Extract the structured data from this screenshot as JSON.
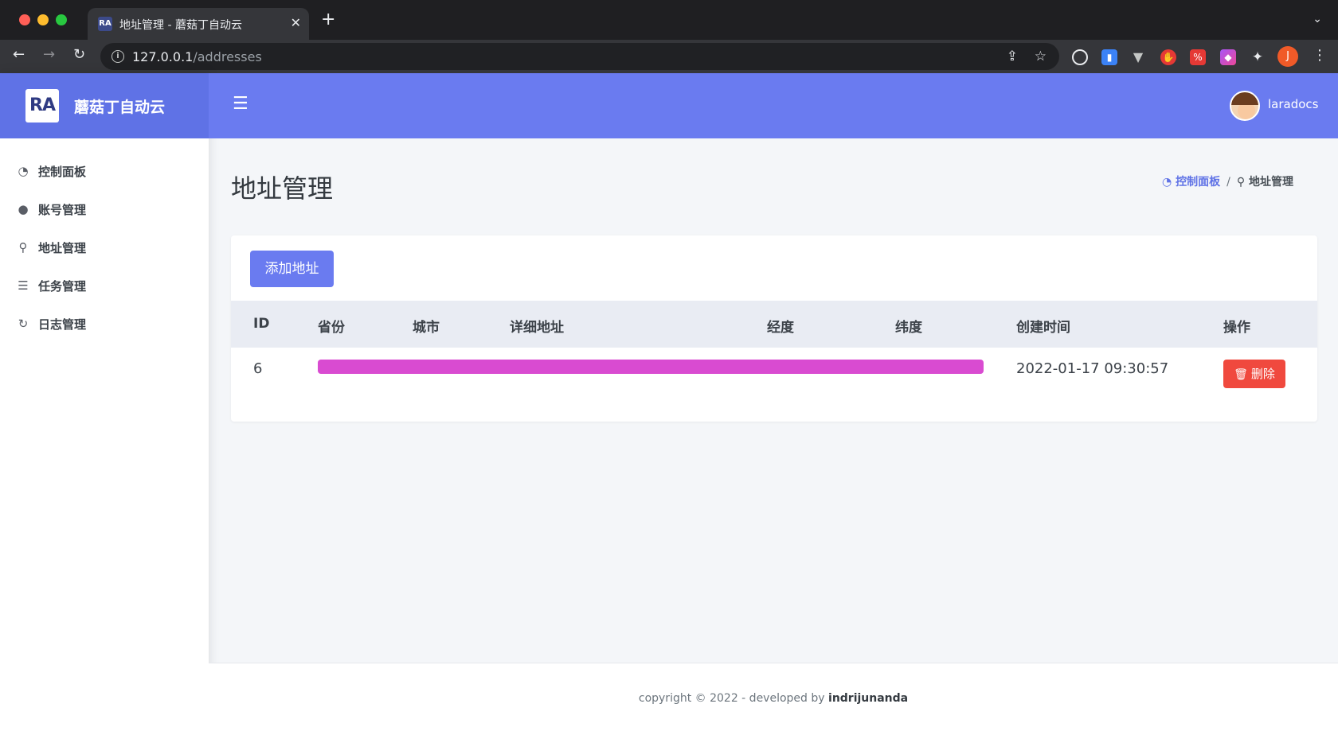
{
  "browser": {
    "tab_title": "地址管理 - 蘑菇丁自动云",
    "tab_favicon": "RA",
    "url_host": "127.0.0.1",
    "url_path": "/addresses",
    "profile_initial": "J",
    "icons": [
      "back-icon",
      "forward-icon",
      "reload-icon",
      "info-icon",
      "share-icon",
      "star-icon",
      "extensions-icon",
      "menu-icon"
    ]
  },
  "brand": {
    "logo": "RA",
    "name": "蘑菇丁自动云",
    "color": "#5f72e6"
  },
  "topbar": {
    "username": "laradocs",
    "color": "#6a7bf0"
  },
  "sidebar": {
    "items": [
      {
        "label": "控制面板",
        "icon": "tachometer-icon"
      },
      {
        "label": "账号管理",
        "icon": "user-icon"
      },
      {
        "label": "地址管理",
        "icon": "map-marker-icon"
      },
      {
        "label": "任务管理",
        "icon": "tasks-icon"
      },
      {
        "label": "日志管理",
        "icon": "redo-icon"
      }
    ]
  },
  "page": {
    "title": "地址管理",
    "breadcrumb": {
      "home": "控制面板",
      "separator": "/",
      "current": "地址管理"
    }
  },
  "card": {
    "add_button": "添加地址"
  },
  "table": {
    "headers": [
      "ID",
      "省份",
      "城市",
      "详细地址",
      "经度",
      "纬度",
      "创建时间",
      "操作"
    ],
    "rows": [
      {
        "id": "6",
        "created_at": "2022-01-17 09:30:57",
        "action": "删除"
      }
    ]
  },
  "footer": {
    "text": "copyright © 2022 - developed by",
    "author": "indrijunanda"
  },
  "colors": {
    "danger": "#f0493e",
    "redaction": "#d94bd1"
  }
}
